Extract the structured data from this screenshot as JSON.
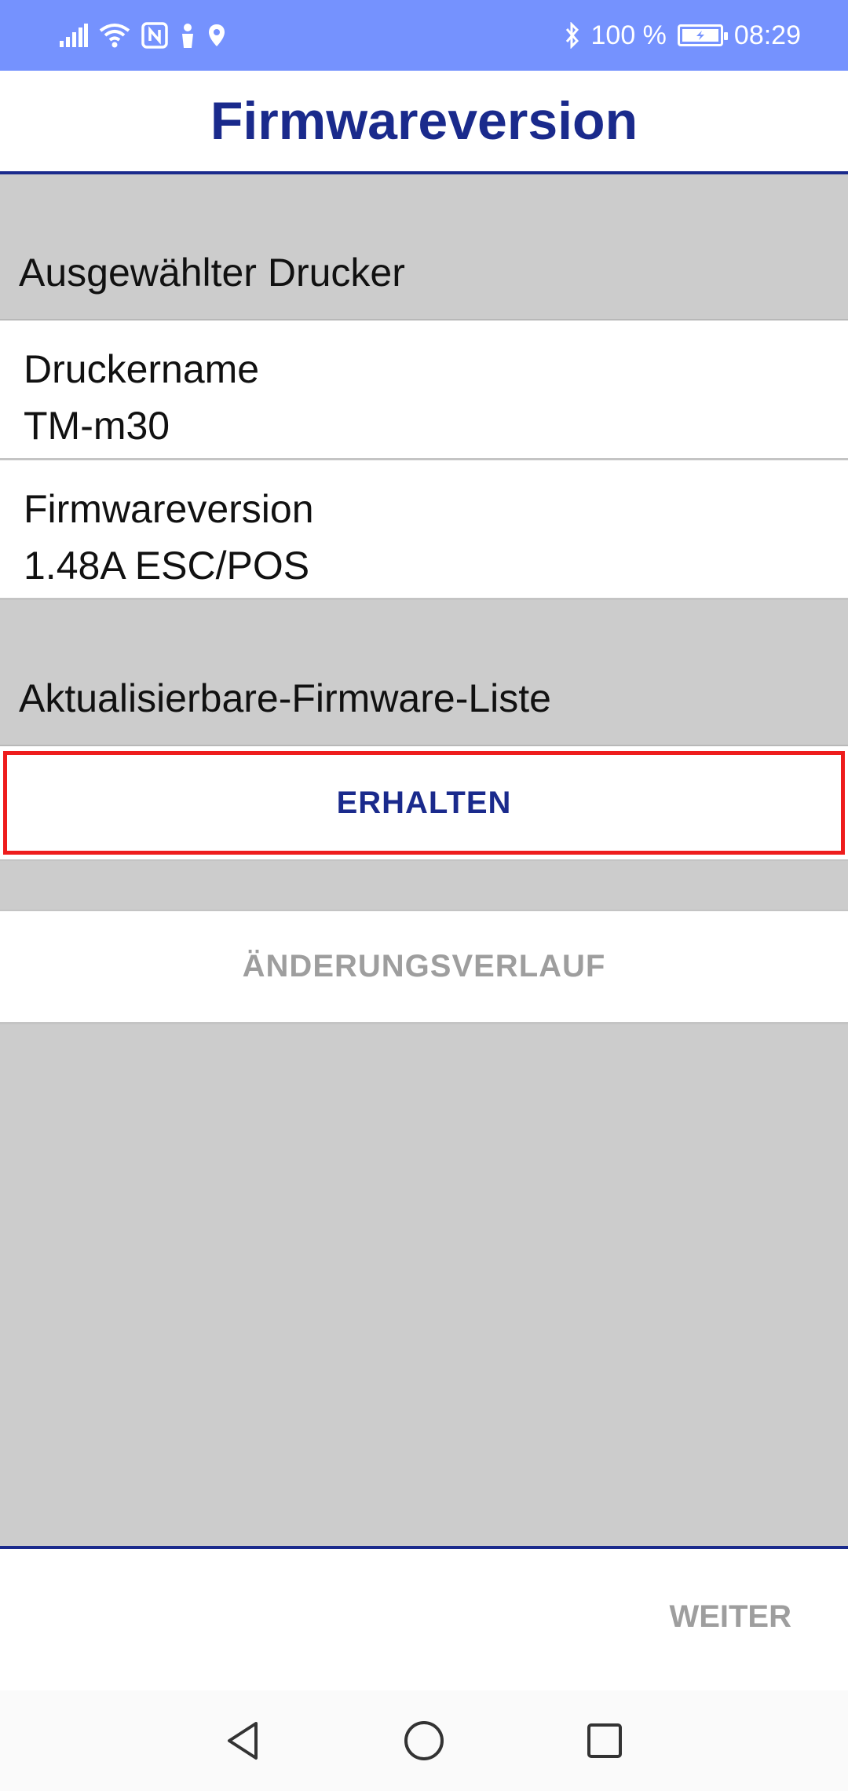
{
  "status_bar": {
    "battery_text": "100 %",
    "time": "08:29",
    "icons": [
      "signal-icon",
      "wifi-icon",
      "nfc-icon",
      "person-icon",
      "location-icon",
      "bluetooth-icon",
      "battery-icon"
    ]
  },
  "header": {
    "title": "Firmwareversion"
  },
  "selected_printer": {
    "section_title": "Ausgewählter Drucker",
    "printer_name_label": "Druckername",
    "printer_name_value": "TM-m30",
    "firmware_label": "Firmwareversion",
    "firmware_value": "1.48A ESC/POS"
  },
  "updatable_list": {
    "section_title": "Aktualisierbare-Firmware-Liste",
    "get_button": "ERHALTEN",
    "history_button": "ÄNDERUNGSVERLAUF"
  },
  "footer": {
    "next_button": "WEITER"
  },
  "colors": {
    "status_bar": "#7592fe",
    "accent": "#1a2a8c",
    "section_gray": "#cccccc",
    "highlight": "#ee1c1c",
    "disabled_text": "#9e9e9e"
  }
}
